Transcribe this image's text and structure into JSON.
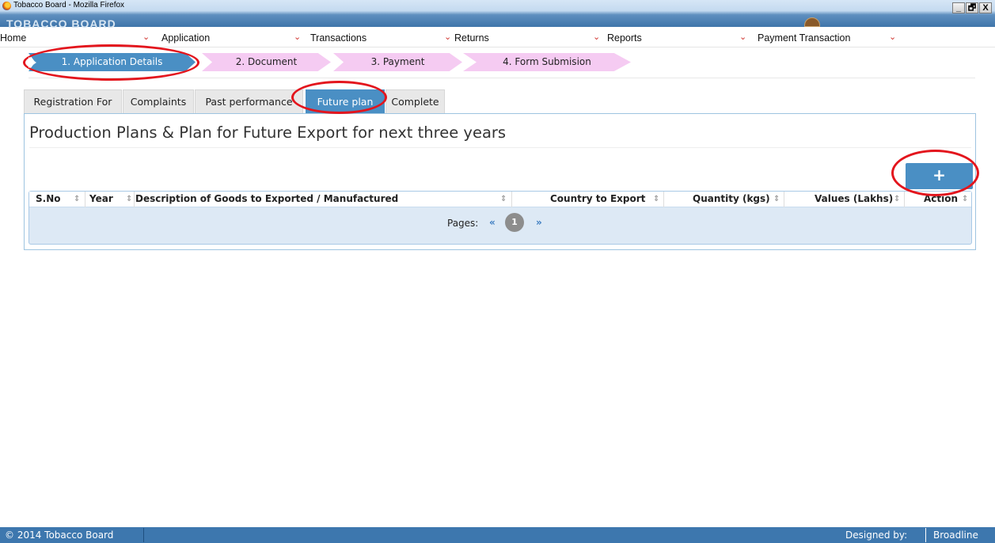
{
  "window": {
    "title": "Tobacco Board - Mozilla Firefox",
    "controls": [
      "_",
      "🗗",
      "X"
    ]
  },
  "menu": [
    {
      "label": "Home"
    },
    {
      "label": "Application"
    },
    {
      "label": "Transactions"
    },
    {
      "label": "Returns"
    },
    {
      "label": "Reports"
    },
    {
      "label": "Payment Transaction"
    }
  ],
  "wizard": {
    "steps": [
      {
        "label": "1. Application Details",
        "state": "active"
      },
      {
        "label": "2. Document",
        "state": "pending"
      },
      {
        "label": "3. Payment",
        "state": "pending"
      },
      {
        "label": "4. Form Submision",
        "state": "pending"
      }
    ]
  },
  "tabs": [
    {
      "label": "Registration For",
      "active": false
    },
    {
      "label": "Complaints",
      "active": false
    },
    {
      "label": "Past performance",
      "active": false
    },
    {
      "label": "Future plan",
      "active": true
    },
    {
      "label": "Complete",
      "active": false
    }
  ],
  "panel": {
    "title": "Production Plans & Plan for Future Export for next three years",
    "add_button": "+"
  },
  "grid": {
    "columns": [
      "S.No",
      "Year",
      "Description of Goods to Exported / Manufactured",
      "Country to Export",
      "Quantity (kgs)",
      "Values (Lakhs)",
      "Action"
    ],
    "sort_glyph": "⇕",
    "rows": [],
    "pager": {
      "label": "Pages:",
      "prev": "«",
      "next": "»",
      "current": "1"
    }
  },
  "footer": {
    "copyright": "© 2014 Tobacco Board",
    "designed_by": "Designed by:",
    "brand": "Broadline"
  },
  "colors": {
    "accent": "#4a8fc4",
    "step_pending": "#f5cbf2",
    "highlight_ring": "#e3151d",
    "footer": "#3d77ae"
  }
}
